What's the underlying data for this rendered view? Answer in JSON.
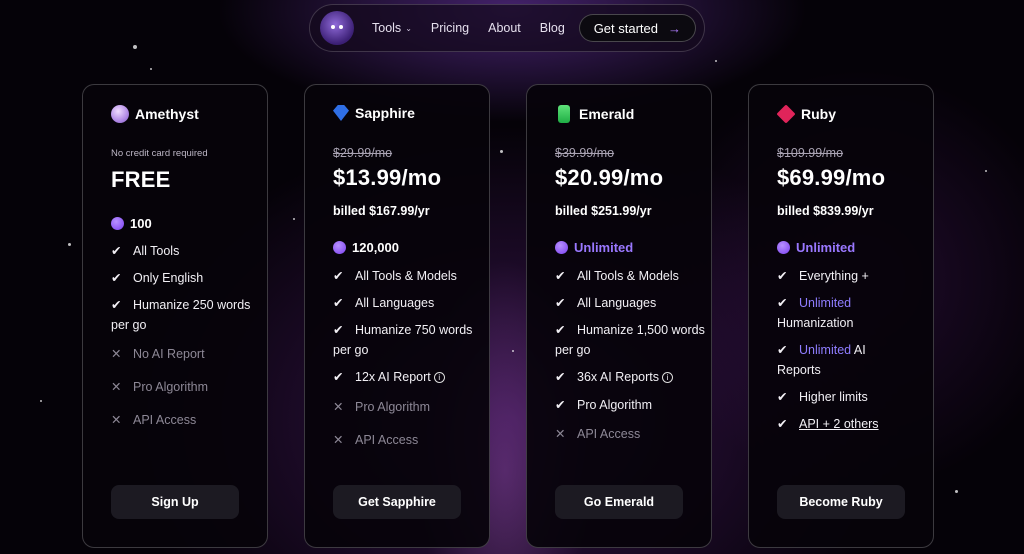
{
  "nav": {
    "tools": "Tools",
    "pricing": "Pricing",
    "about": "About",
    "blog": "Blog",
    "cta": "Get started",
    "cta_arrow": "→",
    "chevron": "⌄"
  },
  "plans": {
    "amethyst": {
      "name": "Amethyst",
      "subtitle": "No credit card required",
      "price": "FREE",
      "credits": "100",
      "features": [
        "All Tools",
        "Only English",
        "Humanize 250 words per go",
        "No AI Report",
        "Pro Algorithm",
        "API Access"
      ],
      "button": "Sign Up"
    },
    "sapphire": {
      "name": "Sapphire",
      "old_price": "$29.99/mo",
      "price": "$13.99/mo",
      "billed": "billed $167.99/yr",
      "credits": "120,000",
      "features": [
        "All Tools & Models",
        "All Languages",
        "Humanize 750 words per go",
        "12x AI Report",
        "Pro Algorithm",
        "API Access"
      ],
      "button": "Get Sapphire"
    },
    "emerald": {
      "name": "Emerald",
      "old_price": "$39.99/mo",
      "price": "$20.99/mo",
      "billed": "billed $251.99/yr",
      "credits": "Unlimited",
      "features": [
        "All Tools & Models",
        "All Languages",
        "Humanize 1,500 words per go",
        "36x AI Reports",
        "Pro Algorithm",
        "API Access"
      ],
      "button": "Go Emerald"
    },
    "ruby": {
      "name": "Ruby",
      "old_price": "$109.99/mo",
      "price": "$69.99/mo",
      "billed": "billed $839.99/yr",
      "credits": "Unlimited",
      "features": [
        "Everything +",
        "Unlimited",
        "Humanization",
        "Unlimited",
        "AI",
        "Reports",
        "Higher limits",
        "API + 2 others"
      ],
      "button": "Become Ruby"
    }
  },
  "glyphs": {
    "check": "✔",
    "cross": "✕",
    "info": "i"
  },
  "colors": {
    "accent": "#9a78ff",
    "background": "#050208",
    "card_border": "#3a3540"
  }
}
